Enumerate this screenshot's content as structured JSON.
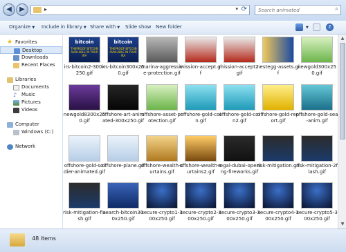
{
  "address": {
    "chevron": "▸",
    "dropdown": "▾",
    "refresh": "⟳"
  },
  "search": {
    "placeholder": "Search animated",
    "icon": "magnifier-icon"
  },
  "toolbar": {
    "organize": "Organize",
    "include": "Include in library",
    "share": "Share with",
    "slideshow": "Slide show",
    "newfolder": "New folder"
  },
  "nav": {
    "favorites": "Favorites",
    "desktop": "Desktop",
    "downloads": "Downloads",
    "recent": "Recent Places",
    "libraries": "Libraries",
    "documents": "Documents",
    "music": "Music",
    "pictures": "Pictures",
    "videos": "Videos",
    "computer": "Computer",
    "windows": "Windows (C:)",
    "network": "Network"
  },
  "thumb_text": {
    "bitcoin": "bitcoin",
    "tagline": "THEPROOF BITCOIN AVAILABLE IN YOUR IRA"
  },
  "files": [
    "irs-bitcoin2-300x250.gif",
    "irs-bitcoin300x250.gif",
    "marina-aggressive-protection.gif",
    "mission-accept.gif",
    "mission-accept2.gif",
    "nestegg-assets.gif",
    "newgold300x250.gif",
    "newgold8300x250.gif",
    "offshore-art-animated-300x250.gif",
    "offshore-asset-protection.gif",
    "offshore-gold-coin.gif",
    "offshore-gold-coin2.gif",
    "offshore-gold-report.gif",
    "offshore-gold-sea-anim.gif",
    "offshore-gold-soldier-animated.gif",
    "offshore-plane.gif",
    "offshore-wealth-curtains.gif",
    "offshore-wealth-curtains2.gif",
    "regal-dubai-opening-fireworks.gif",
    "risk-mitigation.gif",
    "risk-mitigation-2flash.gif",
    "risk-mitigation-flash.gif",
    "search-bitcoin300x250.gif",
    "secure-crypto1-300x250.gif",
    "secure-crypto2-300x250.gif",
    "secure-crypto3-300x250.gif",
    "secure-crypto4-300x250.gif",
    "secure-crypto5-300x250.gif"
  ],
  "status": {
    "count": "48 items"
  }
}
